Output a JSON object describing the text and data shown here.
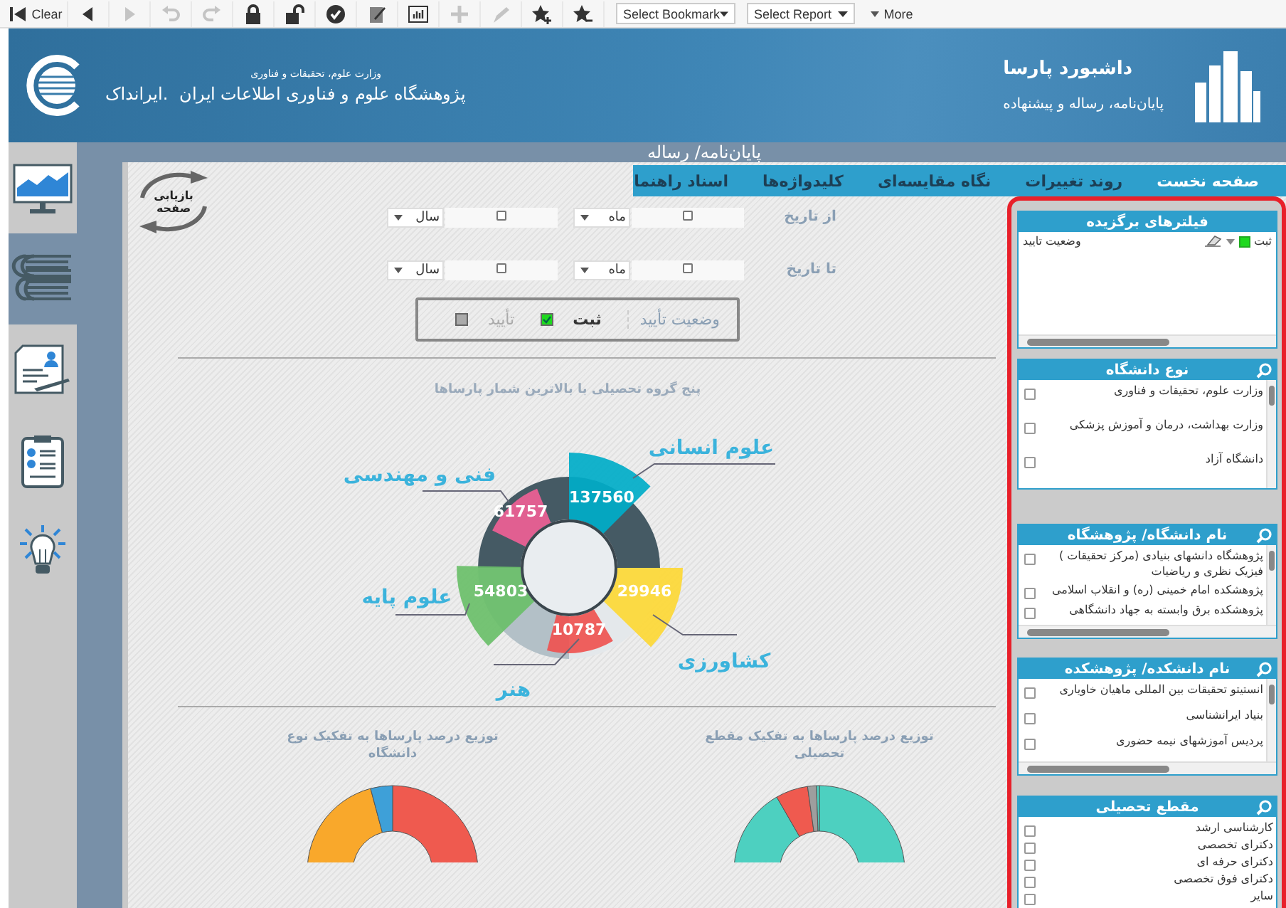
{
  "toolbar": {
    "clear": "Clear",
    "tools": [
      {
        "disabled": false
      },
      {
        "disabled": true
      },
      {
        "disabled": true
      },
      {
        "disabled": true
      },
      {
        "disabled": false
      },
      {
        "disabled": false
      },
      {
        "disabled": false
      },
      {
        "disabled": false
      },
      {
        "disabled": false
      },
      {
        "disabled": true
      },
      {
        "disabled": true
      },
      {
        "disabled": false
      },
      {
        "disabled": false
      }
    ],
    "bookmark_select": "Select Bookmark",
    "report_select": "Select Report",
    "more": "More"
  },
  "header": {
    "ministry": "وزارت علوم، تحقیقات و فناوری",
    "institute": "پژوهشگاه علوم و فناوری اطلاعات ایران",
    "short_name": "ایرانداک.",
    "title": "داشبورد پارسا",
    "subtitle": "پایان‌نامه، رساله و پیشنهاده"
  },
  "sidebar": {
    "items": [
      {
        "selected": false
      },
      {
        "selected": true
      },
      {
        "selected": false
      },
      {
        "selected": false
      },
      {
        "selected": false
      }
    ]
  },
  "page_title": "پایان‌نامه/ رساله",
  "refresh_button": "بازیابی صفحه",
  "tabs": [
    {
      "label": "صفحه نخست",
      "selected": true
    },
    {
      "label": "روند تغییرات",
      "selected": false
    },
    {
      "label": "نگاه مقایسه‌ای",
      "selected": false
    },
    {
      "label": "کلیدواژه‌ها",
      "selected": false
    },
    {
      "label": "اسناد راهنما",
      "selected": false
    }
  ],
  "date_filters": [
    {
      "label": "از تاریخ",
      "month": "ماه",
      "year": "سال"
    },
    {
      "label": "تا تاریخ",
      "month": "ماه",
      "year": "سال"
    }
  ],
  "status_filter": {
    "label": "وضعیت تأیید",
    "options": [
      {
        "label": "ثبت",
        "selected": true
      },
      {
        "label": "تأیید",
        "selected": false
      }
    ]
  },
  "top_groups": {
    "title": "پنج گروه تحصیلی با بالاترین شمار پارساها",
    "groups": [
      {
        "label": "علوم انسانی",
        "value": "137560"
      },
      {
        "label": "فنی و مهندسی",
        "value": "61757"
      },
      {
        "label": "کشاورزی",
        "value": "29946"
      },
      {
        "label": "علوم پایه",
        "value": "54803"
      },
      {
        "label": "هنر",
        "value": "10787"
      }
    ]
  },
  "bottom_charts": [
    {
      "title": "توزیع درصد پارساها به تفکیک مقطع تحصیلی"
    },
    {
      "title": "توزیع درصد پارساها به تفکیک نوع دانشگاه"
    }
  ],
  "filter_panels": [
    {
      "title": "فیلترهای برگزیده",
      "kind": "selections",
      "selections": [
        {
          "field": "وضعیت تایید",
          "value": "ثبت"
        }
      ]
    },
    {
      "title": "نوع دانشگاه",
      "kind": "checklist",
      "items": [
        {
          "label": "وزارت علوم، تحقیقات و فناوری",
          "checked": false
        },
        {
          "label": "وزارت بهداشت، درمان و آموزش پزشکی",
          "checked": false
        },
        {
          "label": "دانشگاه آزاد",
          "checked": false
        }
      ]
    },
    {
      "title": "نام دانشگاه/ پژوهشگاه",
      "kind": "checklist",
      "items": [
        {
          "label": "پژوهشگاه دانشهای بنیادی (مرکز تحقیقات ) فیزیک نظری و ریاضیات",
          "checked": false
        },
        {
          "label": "پژوهشکده امام خمینی (ره) و انقلاب اسلامی",
          "checked": false
        },
        {
          "label": "پژوهشکده برق وابسته به جهاد دانشگاهی",
          "checked": false
        }
      ]
    },
    {
      "title": "نام دانشکده/ پژوهشکده",
      "kind": "checklist",
      "items": [
        {
          "label": "انستیتو تحقیقات بین المللی ماهیان خاویاری",
          "checked": false
        },
        {
          "label": "بنیاد ایرانشناسی",
          "checked": false
        },
        {
          "label": "پردیس آموزشهای نیمه حضوری",
          "checked": false
        }
      ]
    },
    {
      "title": "مقطع تحصیلی",
      "kind": "checklist",
      "items": [
        {
          "label": "کارشناسی ارشد",
          "checked": false
        },
        {
          "label": "دکترای تخصصی",
          "checked": false
        },
        {
          "label": "دکترای حرفه ای",
          "checked": false
        },
        {
          "label": "دکترای فوق تخصصی",
          "checked": false
        },
        {
          "label": "سایر",
          "checked": false
        }
      ]
    }
  ]
}
